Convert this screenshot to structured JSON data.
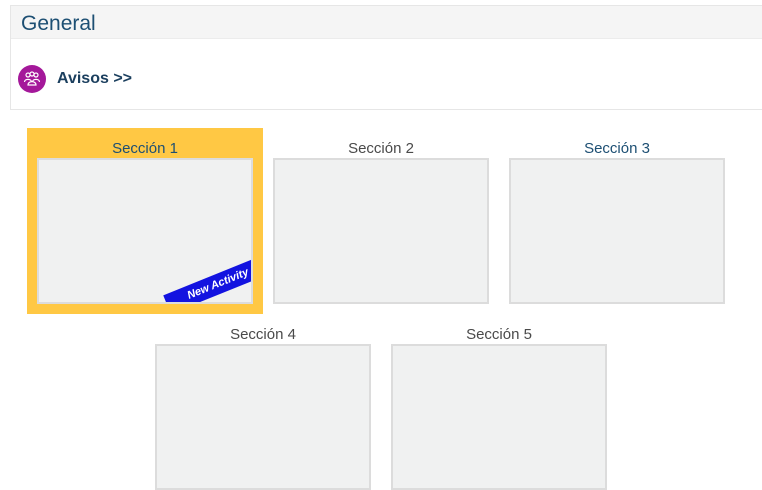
{
  "general": {
    "title": "General"
  },
  "announcements": {
    "label": "Avisos >>",
    "icon": "forum-icon",
    "icon_color": "#a4189a"
  },
  "sections": [
    {
      "label": "Sección 1",
      "highlighted": true,
      "badge": "New Activity",
      "label_color": "#1d4f73"
    },
    {
      "label": "Sección 2",
      "highlighted": false,
      "label_color": "#4a4a4a"
    },
    {
      "label": "Sección 3",
      "highlighted": false,
      "label_color": "#1d4f73"
    },
    {
      "label": "Sección 4",
      "highlighted": false,
      "label_color": "#4a4a4a"
    },
    {
      "label": "Sección 5",
      "highlighted": false,
      "label_color": "#4a4a4a"
    }
  ],
  "colors": {
    "highlight": "#ffc844",
    "badge": "#1313e0",
    "title": "#1d4f73"
  }
}
